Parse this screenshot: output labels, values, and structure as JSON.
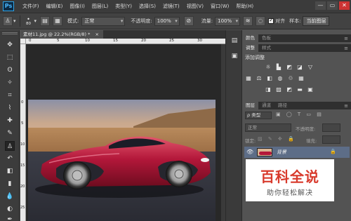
{
  "app": {
    "logo": "Ps"
  },
  "menu": [
    "文件(F)",
    "编辑(E)",
    "图像(I)",
    "图层(L)",
    "类型(Y)",
    "选择(S)",
    "滤镜(T)",
    "视图(V)",
    "窗口(W)",
    "帮助(H)"
  ],
  "window_controls": {
    "minimize": "—",
    "restore": "▭",
    "close": "✕"
  },
  "options": {
    "brush_size": "80",
    "mode_label": "模式:",
    "mode_value": "正常",
    "opacity_label": "不透明度:",
    "opacity_value": "100%",
    "flow_label": "流量:",
    "flow_value": "100%",
    "align_label": "对齐",
    "sample_label": "样本:",
    "sample_value": "当前图层"
  },
  "document": {
    "tab_title": "素材11.jpg @ 22.2%(RGB/8) *",
    "tab_close": "×"
  },
  "rulers": {
    "top": [
      "0",
      "5",
      "10",
      "15",
      "20",
      "25",
      "30"
    ],
    "left": [
      "0",
      "5",
      "10",
      "15",
      "20",
      "25"
    ]
  },
  "panels": {
    "top_tabs": [
      "颜色",
      "色板"
    ],
    "mid_tabs": [
      "调整",
      "样式"
    ],
    "adjust_title": "添加调整",
    "layers_tabs": [
      "图层",
      "通道",
      "路径"
    ],
    "filter_kind": "ρ 类型",
    "blend_mode": "正常",
    "opacity_label": "不透明度:",
    "lock_label": "锁定:",
    "fill_label": "填充:",
    "layer_name": "背景"
  },
  "watermark": {
    "title": "百科全说",
    "subtitle": "助你轻松解决"
  }
}
